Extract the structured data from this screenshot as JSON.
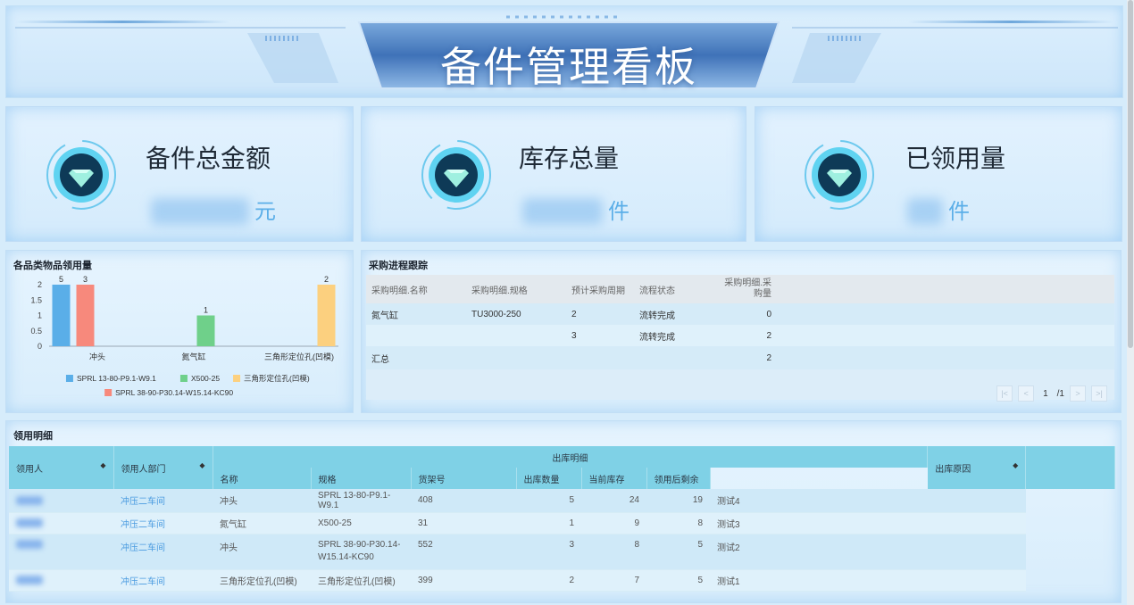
{
  "header": {
    "title": "备件管理看板"
  },
  "kpis": [
    {
      "label": "备件总金额",
      "unit": "元"
    },
    {
      "label": "库存总量",
      "unit": "件"
    },
    {
      "label": "已领用量",
      "unit": "件"
    }
  ],
  "chart_panel": {
    "title": "各品类物品领用量"
  },
  "chart_data": {
    "type": "bar",
    "categories": [
      "冲头",
      "氮气缸",
      "三角形定位孔(凹模)"
    ],
    "ylim": [
      0,
      2
    ],
    "yticks": [
      "0",
      "0.5",
      "1",
      "1.5",
      "2"
    ],
    "series": [
      {
        "name": "SPRL 13-80-P9.1-W9.1",
        "color": "#5aaee8",
        "values": [
          5,
          null,
          null
        ]
      },
      {
        "name": "SPRL 38-90-P30.14-W15.14-KC90",
        "color": "#f7897c",
        "values": [
          3,
          null,
          null
        ]
      },
      {
        "name": "X500-25",
        "color": "#6fd08a",
        "values": [
          null,
          1,
          null
        ]
      },
      {
        "name": "三角形定位孔(凹模)",
        "color": "#fcd07f",
        "values": [
          null,
          null,
          2
        ]
      }
    ]
  },
  "purchase": {
    "title": "采购进程跟踪",
    "headers": [
      "采购明细.名称",
      "采购明细.规格",
      "预计采购周期",
      "流程状态",
      "采购明细.采购量"
    ],
    "rows": [
      [
        "氮气缸",
        "TU3000-250",
        "2",
        "流转完成",
        "0"
      ],
      [
        "",
        "",
        "3",
        "流转完成",
        "2"
      ]
    ],
    "total_label": "汇总",
    "total_value": "2",
    "pager": {
      "current": "1",
      "total": "/1"
    }
  },
  "detail": {
    "title": "领用明细",
    "headers": {
      "person": "领用人",
      "dept": "领用人部门",
      "group": "出库明细",
      "name": "名称",
      "spec": "规格",
      "shelf": "货架号",
      "out_qty": "出库数量",
      "stock": "当前库存",
      "remain": "领用后剩余",
      "reason": "出库原因"
    },
    "sort_icon": "◆",
    "rows": [
      {
        "dept": "冲压二车间",
        "name": "冲头",
        "spec": "SPRL 13-80-P9.1-W9.1",
        "shelf": "408",
        "out_qty": "5",
        "stock": "24",
        "remain": "19",
        "reason": "测试4"
      },
      {
        "dept": "冲压二车间",
        "name": "氮气缸",
        "spec": "X500-25",
        "shelf": "31",
        "out_qty": "1",
        "stock": "9",
        "remain": "8",
        "reason": "测试3"
      },
      {
        "dept": "冲压二车间",
        "name": "冲头",
        "spec": "SPRL 38-90-P30.14-W15.14-KC90",
        "shelf": "552",
        "out_qty": "3",
        "stock": "8",
        "remain": "5",
        "reason": "测试2"
      },
      {
        "dept": "冲压二车间",
        "name": "三角形定位孔(凹模)",
        "spec": "三角形定位孔(凹模)",
        "shelf": "399",
        "out_qty": "2",
        "stock": "7",
        "remain": "5",
        "reason": "测试1"
      }
    ]
  }
}
